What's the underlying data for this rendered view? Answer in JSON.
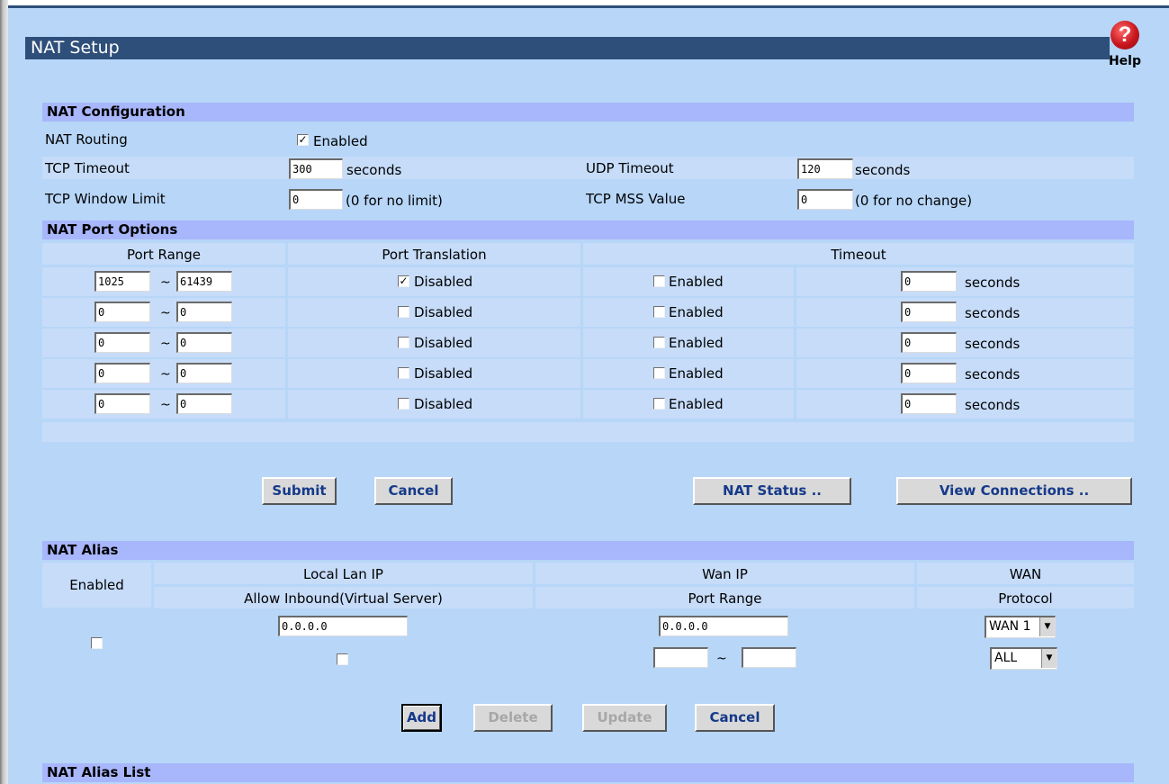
{
  "page": {
    "title": "NAT Setup",
    "help_label": "Help",
    "help_glyph": "?"
  },
  "nat_config": {
    "heading": "NAT Configuration",
    "nat_routing_label": "NAT Routing",
    "nat_routing_option": "Enabled",
    "nat_routing_checked": true,
    "tcp_timeout_label": "TCP Timeout",
    "tcp_timeout_value": "300",
    "tcp_timeout_unit": "seconds",
    "udp_timeout_label": "UDP Timeout",
    "udp_timeout_value": "120",
    "udp_timeout_unit": "seconds",
    "tcp_window_label": "TCP Window Limit",
    "tcp_window_value": "0",
    "tcp_window_hint": "(0 for no limit)",
    "tcp_mss_label": "TCP MSS Value",
    "tcp_mss_value": "0",
    "tcp_mss_hint": "(0 for no change)"
  },
  "port_options": {
    "heading": "NAT Port Options",
    "col_port_range": "Port Range",
    "col_port_translation": "Port Translation",
    "col_timeout": "Timeout",
    "translation_label": "Disabled",
    "timeout_enabled_label": "Enabled",
    "seconds_label": "seconds",
    "tilde": "~",
    "rows": [
      {
        "start": "1025",
        "end": "61439",
        "translation_checked": true,
        "timeout_checked": false,
        "timeout": "0"
      },
      {
        "start": "0",
        "end": "0",
        "translation_checked": false,
        "timeout_checked": false,
        "timeout": "0"
      },
      {
        "start": "0",
        "end": "0",
        "translation_checked": false,
        "timeout_checked": false,
        "timeout": "0"
      },
      {
        "start": "0",
        "end": "0",
        "translation_checked": false,
        "timeout_checked": false,
        "timeout": "0"
      },
      {
        "start": "0",
        "end": "0",
        "translation_checked": false,
        "timeout_checked": false,
        "timeout": "0"
      }
    ]
  },
  "buttons": {
    "submit": "Submit",
    "cancel": "Cancel",
    "nat_status": "NAT Status ..",
    "view_connections": "View Connections .."
  },
  "nat_alias": {
    "heading": "NAT Alias",
    "col_enabled": "Enabled",
    "col_local_lan_ip": "Local Lan IP",
    "col_allow_inbound": "Allow Inbound(Virtual Server)",
    "col_wan_ip": "Wan IP",
    "col_port_range": "Port Range",
    "col_wan": "WAN",
    "col_protocol": "Protocol",
    "local_ip_value": "0.0.0.0",
    "wan_ip_value": "0.0.0.0",
    "port_start_value": "",
    "port_end_value": "",
    "tilde": "~",
    "wan_select": "WAN 1",
    "protocol_select": "ALL",
    "add": "Add",
    "delete": "Delete",
    "update": "Update",
    "cancel": "Cancel"
  },
  "nat_alias_list": {
    "heading": "NAT Alias List"
  },
  "icons": {
    "help": "help-icon",
    "check": "checkmark-icon",
    "dropdown": "chevron-down-icon"
  },
  "colors": {
    "background": "#b7d6f8",
    "title_bar": "#2e4f7a",
    "section_header": "#a8b6fb",
    "row_band": "#c6dcf9",
    "button_text": "#163a8a",
    "disabled_text": "#a7a7a7"
  }
}
